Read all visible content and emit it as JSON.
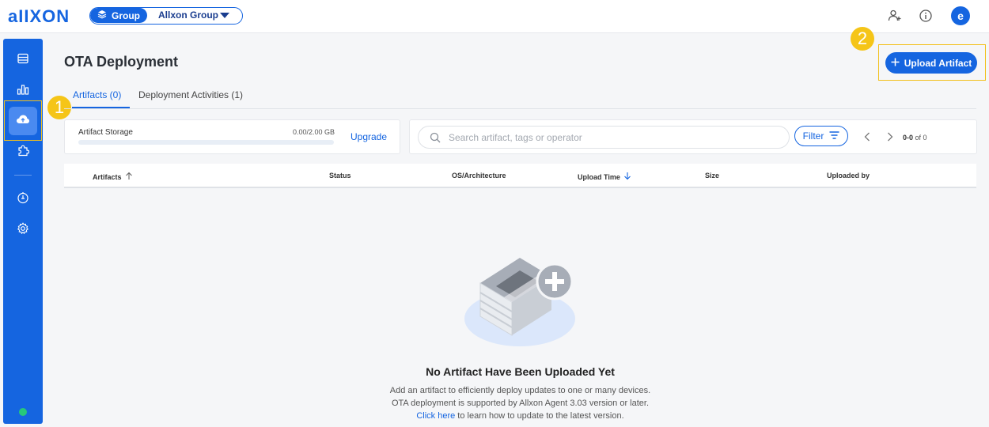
{
  "header": {
    "logo": "aIIXON",
    "group_chip_label": "Group",
    "group_name": "Allxon Group",
    "avatar_letter": "e"
  },
  "markers": {
    "one": "1",
    "two": "2"
  },
  "page": {
    "title": "OTA Deployment",
    "upload_label": "Upload Artifact"
  },
  "tabs": [
    {
      "label": "Artifacts (0)",
      "active": true
    },
    {
      "label": "Deployment Activities (1)",
      "active": false
    }
  ],
  "storage": {
    "label": "Artifact Storage",
    "value": "0.00/2.00 GB",
    "used_fraction": 0,
    "upgrade_label": "Upgrade"
  },
  "search": {
    "placeholder": "Search artifact, tags or operator",
    "value": "",
    "filter_label": "Filter",
    "pager_range": "0-0",
    "pager_total": " of 0"
  },
  "table": {
    "columns": [
      "Artifacts",
      "Status",
      "OS/Architecture",
      "Upload Time",
      "Size",
      "Uploaded by"
    ]
  },
  "empty": {
    "title": "No Artifact Have Been Uploaded Yet",
    "line1": "Add an artifact to efficiently deploy updates to one or many devices.",
    "line2": "OTA deployment is supported by Allxon Agent 3.03 version or later.",
    "link_text": "Click here",
    "line3_rest": " to learn how to update to the latest version."
  },
  "colors": {
    "brand": "#1565e0",
    "highlight": "#f2c01b",
    "status_online": "#27c77a"
  },
  "icons": {
    "sidebar": [
      "devices-icon",
      "analytics-icon",
      "ota-cloud-upload-icon",
      "plugins-icon",
      "alerts-icon",
      "settings-icon"
    ],
    "top": [
      "add-user-icon",
      "info-icon"
    ]
  }
}
